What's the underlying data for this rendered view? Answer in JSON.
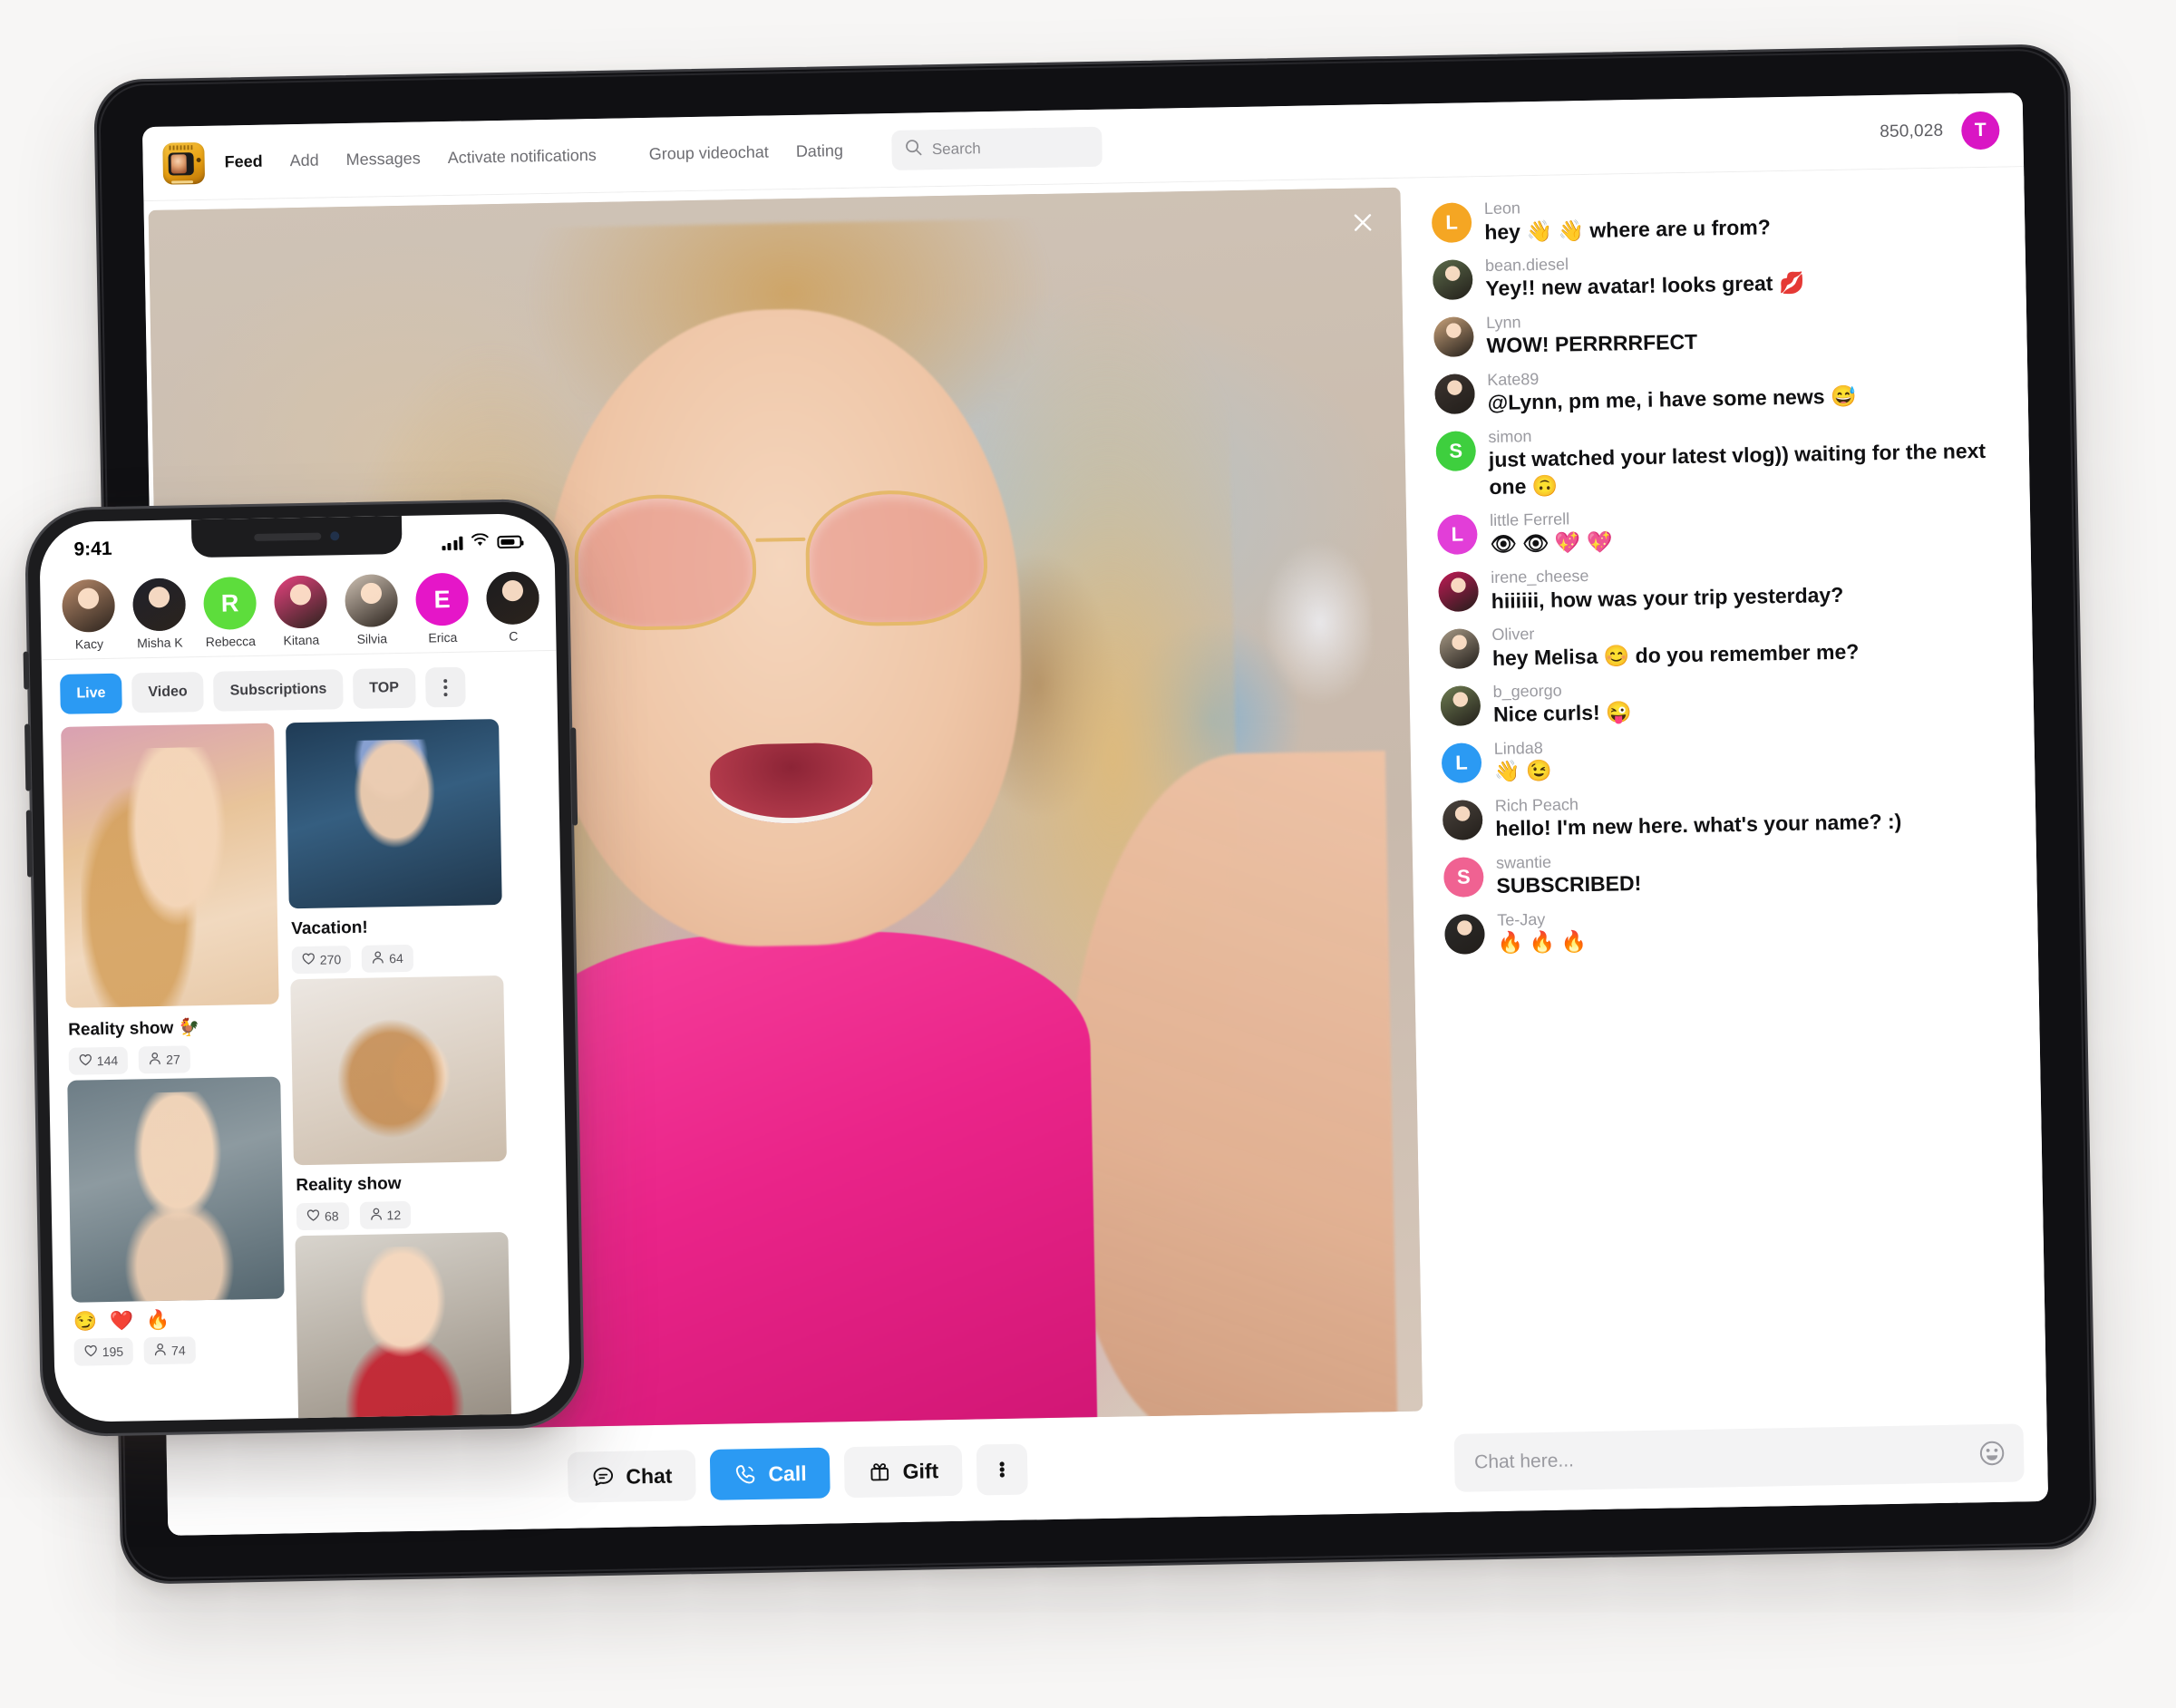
{
  "tablet": {
    "nav": {
      "logo_icon": "tv-app-logo-icon",
      "links": [
        {
          "label": "Feed",
          "active": true
        },
        {
          "label": "Add",
          "active": false
        },
        {
          "label": "Messages",
          "active": false
        },
        {
          "label": "Activate notifications",
          "active": false
        },
        {
          "label": "Group videochat",
          "active": false
        },
        {
          "label": "Dating",
          "active": false
        }
      ],
      "search_placeholder": "Search",
      "search_icon": "search-icon",
      "balance": "850,028",
      "avatar_initial": "T",
      "avatar_color": "#d916c4"
    },
    "stream": {
      "close_icon": "close-icon",
      "actions": [
        {
          "label": "Chat",
          "icon": "chat-bubble-icon",
          "primary": false
        },
        {
          "label": "Call",
          "icon": "phone-call-icon",
          "primary": true
        },
        {
          "label": "Gift",
          "icon": "gift-icon",
          "primary": false
        },
        {
          "label": "",
          "icon": "more-vertical-icon",
          "primary": false
        }
      ]
    },
    "chat": {
      "messages": [
        {
          "user": "Leon",
          "text": "hey 👋 👋  where are u from?",
          "avatar_type": "initial",
          "initial": "L",
          "color": "#f5a623"
        },
        {
          "user": "bean.diesel",
          "text": "Yey!! new avatar! looks great 💋",
          "avatar_type": "photo",
          "color": "#5c6b4a"
        },
        {
          "user": "Lynn",
          "text": "WOW! PERRRRFECT",
          "avatar_type": "photo",
          "color": "#c9a27a"
        },
        {
          "user": "Kate89",
          "text": "@Lynn, pm me, i have some news 😅",
          "avatar_type": "photo",
          "color": "#3c3430"
        },
        {
          "user": "simon",
          "text": "just watched your latest vlog)) waiting for the next one 🙃",
          "avatar_type": "initial",
          "initial": "S",
          "color": "#3ecf3e"
        },
        {
          "user": "little Ferrell",
          "text": "👁 👁 💖 💖",
          "avatar_type": "initial",
          "initial": "L",
          "color": "#e23ed8"
        },
        {
          "user": "irene_cheese",
          "text": "hiiiiii, how was your trip yesterday?",
          "avatar_type": "photo",
          "color": "#c11a55"
        },
        {
          "user": "Oliver",
          "text": "hey Melisa 😊  do you remember me?",
          "avatar_type": "photo",
          "color": "#a89a86"
        },
        {
          "user": "b_georgo",
          "text": "Nice curls! 😜",
          "avatar_type": "photo",
          "color": "#6f7d52"
        },
        {
          "user": "Linda8",
          "text": "👋 😉",
          "avatar_type": "initial",
          "initial": "L",
          "color": "#2b9af3"
        },
        {
          "user": "Rich Peach",
          "text": "hello! I'm new here. what's your name? :)",
          "avatar_type": "photo",
          "color": "#4a433d"
        },
        {
          "user": "swantie",
          "text": "SUBSCRIBED!",
          "avatar_type": "initial",
          "initial": "S",
          "color": "#f06292"
        },
        {
          "user": "Te-Jay",
          "text": "🔥 🔥 🔥",
          "avatar_type": "photo",
          "color": "#2b2b2b"
        }
      ],
      "input_placeholder": "Chat here...",
      "emoji_icon": "emoji-smiley-icon"
    }
  },
  "phone": {
    "status": {
      "time": "9:41",
      "signal_icon": "cellular-bars-icon",
      "wifi_icon": "wifi-icon",
      "battery_icon": "battery-icon"
    },
    "stories": [
      {
        "name": "Kacy",
        "type": "photo",
        "color": "#b88a6a"
      },
      {
        "name": "Misha K",
        "type": "photo",
        "color": "#20222b"
      },
      {
        "name": "Rebecca",
        "type": "initial",
        "initial": "R",
        "color": "#5ddd3c"
      },
      {
        "name": "Kitana",
        "type": "photo",
        "color": "#e8427f"
      },
      {
        "name": "Silvia",
        "type": "photo",
        "color": "#cfc2b4"
      },
      {
        "name": "Erica",
        "type": "initial",
        "initial": "E",
        "color": "#e516c8"
      },
      {
        "name": "C",
        "type": "photo",
        "color": "#1c1c1e"
      }
    ],
    "filters": [
      {
        "label": "Live",
        "active": true
      },
      {
        "label": "Video",
        "active": false
      },
      {
        "label": "Subscriptions",
        "active": false
      },
      {
        "label": "TOP",
        "active": false
      },
      {
        "label": "",
        "active": false,
        "icon": "more-vertical-icon"
      }
    ],
    "feed": {
      "left_column": [
        {
          "title": "Reality show 🐓",
          "emojis": "",
          "likes": "144",
          "viewers": "27",
          "photo_class": "ph1"
        },
        {
          "title": "",
          "emojis": "😏 ❤️ 🔥",
          "likes": "195",
          "viewers": "74",
          "photo_class": "ph4"
        }
      ],
      "right_column": [
        {
          "title": "Vacation!",
          "emojis": "",
          "likes": "270",
          "viewers": "64",
          "photo_class": "ph2"
        },
        {
          "title": "Reality show",
          "emojis": "",
          "likes": "68",
          "viewers": "12",
          "photo_class": "ph3"
        },
        {
          "title": "",
          "emojis": "",
          "likes": "",
          "viewers": "",
          "photo_class": "ph5"
        }
      ]
    },
    "stat_like_icon": "heart-outline-icon",
    "stat_viewer_icon": "person-icon"
  }
}
